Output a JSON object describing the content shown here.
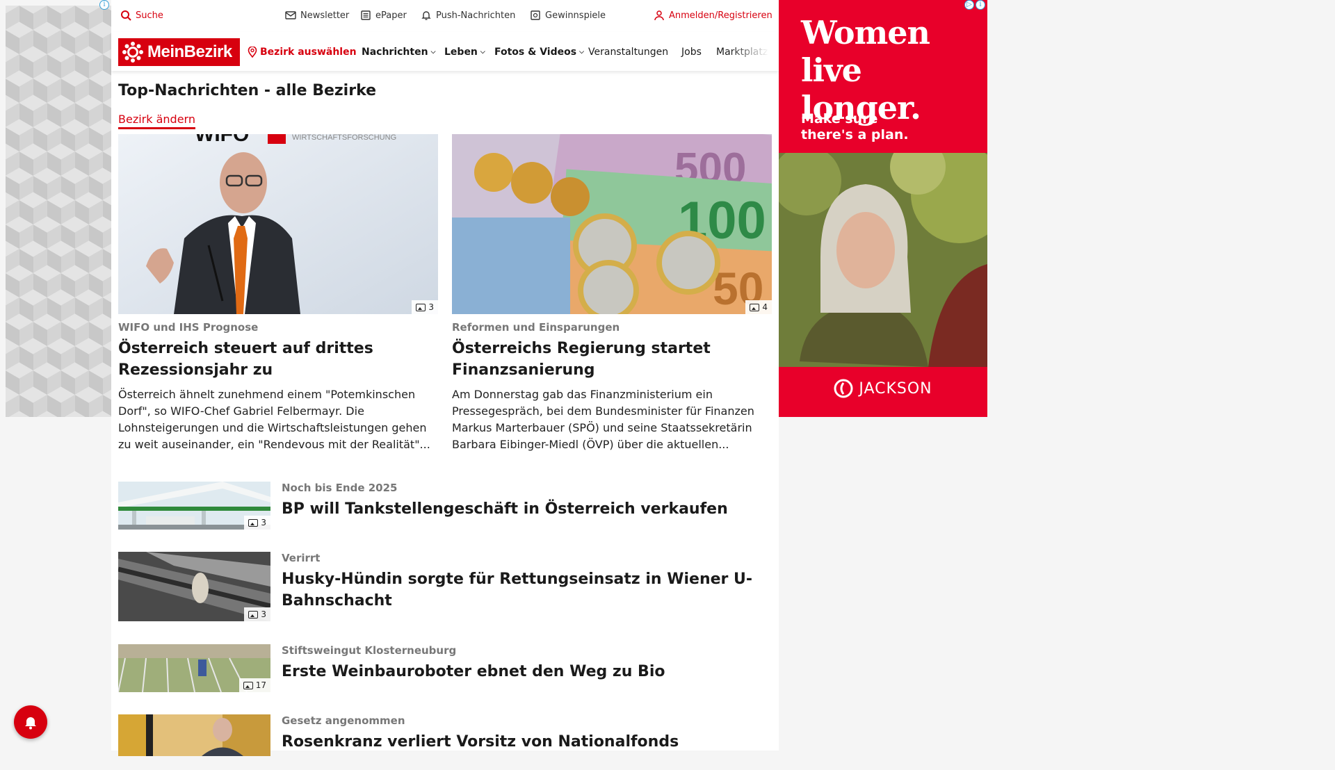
{
  "topbar": {
    "search": "Suche",
    "newsletter": "Newsletter",
    "epaper": "ePaper",
    "push": "Push-Nachrichten",
    "gewinnspiele": "Gewinnspiele",
    "login": "Anmelden/Registrieren"
  },
  "nav": {
    "logo": "MeinBezirk",
    "bezirk": "Bezirk auswählen",
    "items": [
      "Nachrichten",
      "Leben",
      "Fotos & Videos",
      "Veranstaltungen",
      "Jobs",
      "Marktplatz"
    ]
  },
  "main": {
    "heading": "Top-Nachrichten - alle Bezirke",
    "change_link": "Bezirk ändern",
    "featured": [
      {
        "kicker": "WIFO und IHS Prognose",
        "title": "Österreich steuert auf drittes Rezessionsjahr zu",
        "teaser": "Österreich ähnelt zunehmend einem \"Potemkinschen Dorf\", so WIFO-Chef Gabriel Felbermayr. Die Lohnsteigerungen und die Wirtschaftsleistungen gehen zu weit auseinander, ein \"Rendevous mit der Realität\"...",
        "photo_count": "3",
        "image_text": "WIFO",
        "image_text2": "WIRTSCHAFTSFORSCHUNG"
      },
      {
        "kicker": "Reformen und Einsparungen",
        "title": "Österreichs Regierung startet Finanzsanierung",
        "teaser": "Am Donnerstag gab das Finanzministerium ein Pressegespräch, bei dem Bundesminister für Finanzen Markus Marterbauer (SPÖ) und seine Staatssekretärin Barbara Eibinger-Miedl (ÖVP) über die aktuellen...",
        "photo_count": "4",
        "image_text": "500",
        "image_text2": "100",
        "image_text3": "50"
      }
    ],
    "list": [
      {
        "kicker": "Noch bis Ende 2025",
        "title": "BP will Tankstellengeschäft in Österreich verkaufen",
        "photo_count": "3"
      },
      {
        "kicker": "Verirrt",
        "title": "Husky-Hündin sorgte für Rettungseinsatz in Wiener U-Bahnschacht",
        "photo_count": "3"
      },
      {
        "kicker": "Stiftsweingut Klosterneuburg",
        "title": "Erste Weinbauroboter ebnet den Weg zu Bio",
        "photo_count": "17"
      },
      {
        "kicker": "Gesetz angenommen",
        "title": "Rosenkranz verliert Vorsitz von Nationalfonds",
        "photo_count": ""
      }
    ]
  },
  "ad": {
    "headline_1": "Women",
    "headline_2": "live longer.",
    "sub_1": "Make sure",
    "sub_2": "there's a plan.",
    "brand": "JACKSON",
    "info": "i"
  },
  "colors": {
    "brand_red": "#d7000f",
    "ad_red": "#e8002a"
  }
}
